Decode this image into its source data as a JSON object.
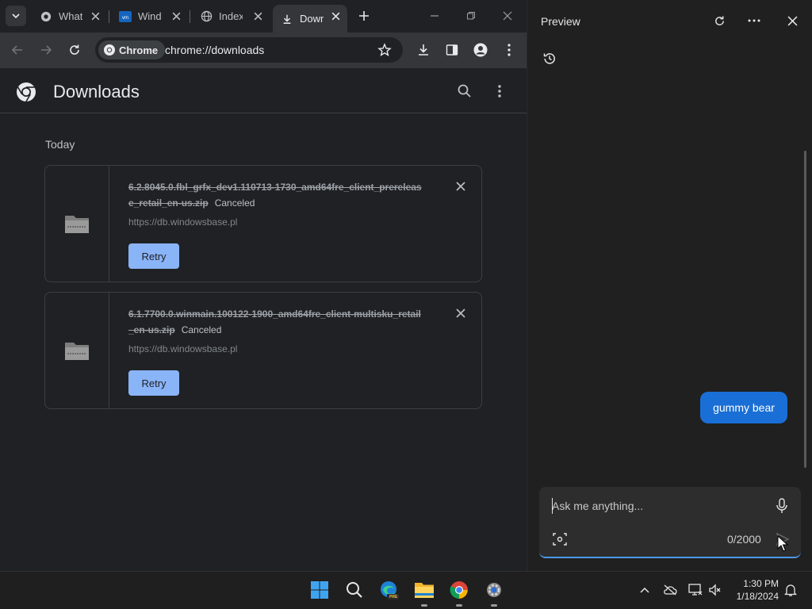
{
  "tabs": [
    {
      "title": "What"
    },
    {
      "title": "Wind"
    },
    {
      "title": "Index"
    },
    {
      "title": "Down"
    }
  ],
  "toolbar": {
    "site_chip": "Chrome",
    "url": "chrome://downloads"
  },
  "page": {
    "title": "Downloads",
    "section_label": "Today"
  },
  "downloads": [
    {
      "filename": "6.2.8045.0.fbl_grfx_dev1.110713-1730_amd64fre_client_prerelease_retail_en-us.zip",
      "status": "Canceled",
      "url": "https://db.windowsbase.pl",
      "retry_label": "Retry"
    },
    {
      "filename": "6.1.7700.0.winmain.100122-1900_amd64fre_client-multisku_retail_en-us.zip",
      "status": "Canceled",
      "url": "https://db.windowsbase.pl",
      "retry_label": "Retry"
    }
  ],
  "pane": {
    "title": "Preview",
    "user_message": "gummy bear",
    "input_placeholder": "Ask me anything...",
    "char_count": "0/2000"
  },
  "taskbar": {
    "time": "1:30 PM",
    "date": "1/18/2024",
    "edge_badge": "PRE"
  },
  "colors": {
    "accent": "#8ab4f8",
    "bubble": "#1a6fd6"
  }
}
